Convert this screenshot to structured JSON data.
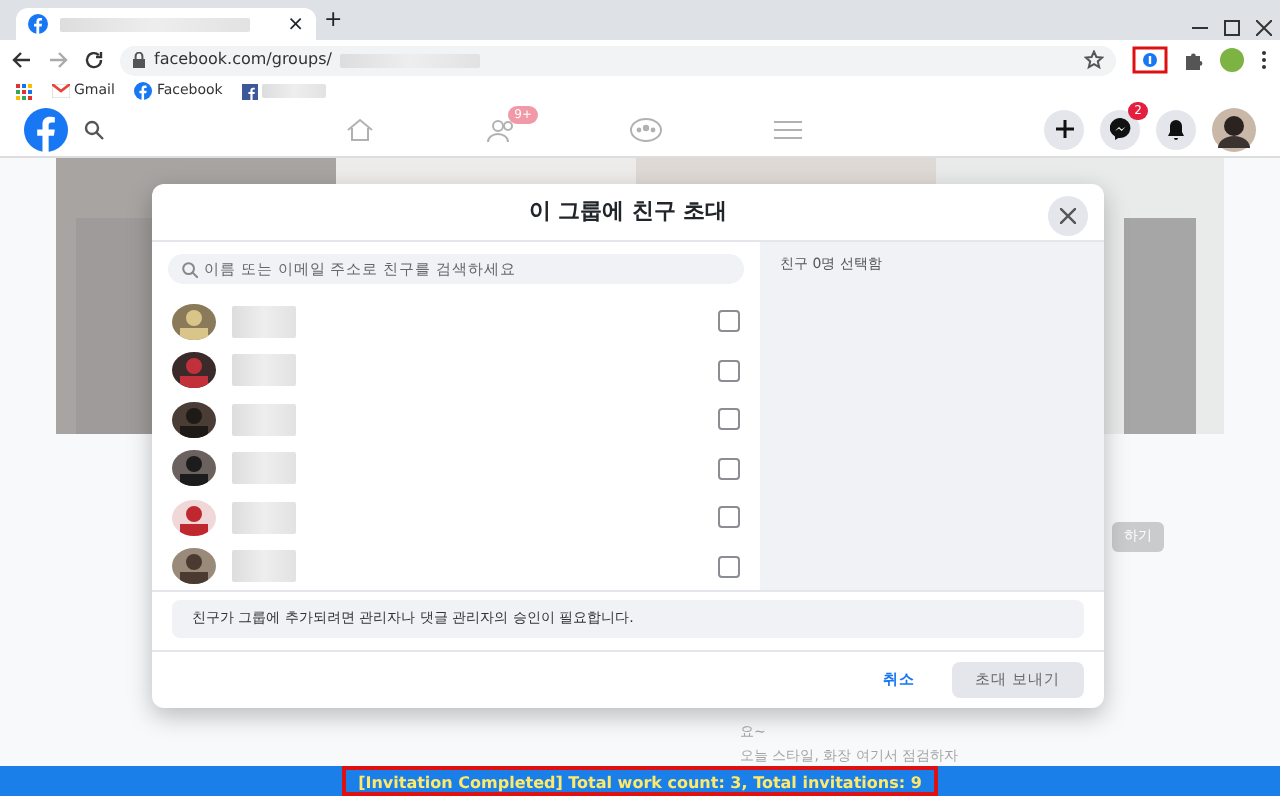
{
  "browser": {
    "tab_close": "×",
    "new_tab": "+",
    "address": "facebook.com/groups/",
    "bookmarks": [
      {
        "kind": "gmail",
        "label": "Gmail"
      },
      {
        "kind": "facebook",
        "label": "Facebook"
      }
    ]
  },
  "header": {
    "messenger_badge": "2",
    "friends_badge": "9+"
  },
  "background": {
    "lines": [
      "요~",
      "오늘 스타일, 화장 여기서 점검하자"
    ],
    "button": "하기"
  },
  "dialog": {
    "title": "이 그룹에 친구 초대",
    "search": {
      "placeholder": "이름 또는 이메일 주소로 친구를 검색하세요"
    },
    "friends": [
      {
        "checked": false
      },
      {
        "checked": false
      },
      {
        "checked": false
      },
      {
        "checked": false
      },
      {
        "checked": false
      },
      {
        "checked": false
      }
    ],
    "selected_count": "친구 0명 선택함",
    "note": "친구가 그룹에 추가되려면 관리자나 댓글 관리자의 승인이 필요합니다.",
    "cancel": "취소",
    "send": {
      "label": "초대 보내기",
      "disabled": true
    }
  },
  "status_bar": "[Invitation Completed] Total work count: 3, Total invitations: 9"
}
